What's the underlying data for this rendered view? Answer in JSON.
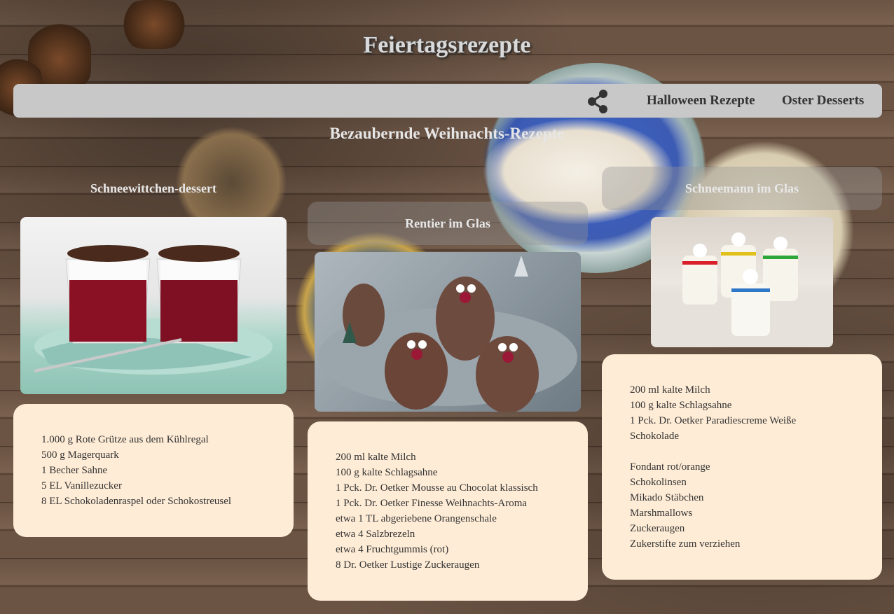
{
  "site": {
    "title": "Feiertagsrezepte"
  },
  "nav": {
    "share_icon": "share-icon",
    "links": [
      {
        "label": "Halloween Rezepte"
      },
      {
        "label": "Oster Desserts"
      }
    ]
  },
  "section": {
    "heading": "Bezaubernde Weihnachts-Rezepte"
  },
  "recipes": [
    {
      "title": "Schneewittchen-dessert",
      "ingredients": [
        "1.000 g Rote Grütze aus dem Kühlregal",
        "500 g Magerquark",
        "1 Becher Sahne",
        "5 EL Vanillezucker",
        "8 EL Schokoladenraspel oder Schokostreusel"
      ]
    },
    {
      "title": "Rentier im Glas",
      "ingredients": [
        "200 ml kalte Milch",
        "100 g kalte Schlagsahne",
        "1 Pck. Dr. Oetker Mousse au Chocolat klassisch",
        "1 Pck. Dr. Oetker Finesse Weihnachts-Aroma",
        "etwa 1 TL abgeriebene Orangenschale",
        "etwa 4 Salzbrezeln",
        "etwa 4 Fruchtgummis (rot)",
        "8 Dr. Oetker Lustige Zuckeraugen"
      ]
    },
    {
      "title": "Schneemann im Glas",
      "ingredients": [
        "200 ml kalte Milch",
        "100 g kalte Schlagsahne",
        "1 Pck. Dr. Oetker Paradiescreme Weiße",
        "Schokolade",
        "",
        "Fondant rot/orange",
        "Schokolinsen",
        "Mikado Stäbchen",
        "Marshmallows",
        "Zuckeraugen",
        "Zukerstifte zum verziehen"
      ]
    }
  ]
}
